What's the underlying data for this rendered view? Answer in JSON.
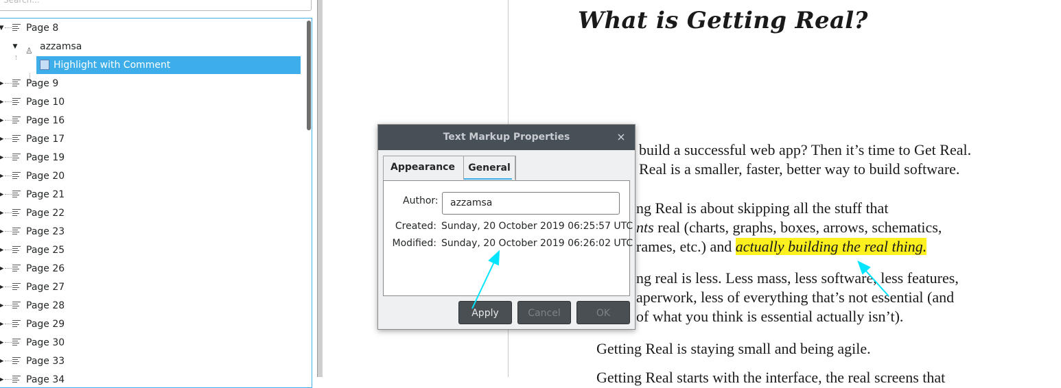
{
  "left_panel": {
    "search_placeholder": "Search...",
    "tree": {
      "page_8": "Page 8",
      "user": "azzamsa",
      "annotation": "Highlight with Comment",
      "pages": [
        "Page 9",
        "Page 10",
        "Page 16",
        "Page 17",
        "Page 19",
        "Page 20",
        "Page 21",
        "Page 22",
        "Page 23",
        "Page 25",
        "Page 26",
        "Page 27",
        "Page 28",
        "Page 29",
        "Page 30",
        "Page 33",
        "Page 34"
      ]
    }
  },
  "document": {
    "title": "What is Getting Real?",
    "lines": {
      "l1": "build a successful web app? Then it’s time to Get Real.",
      "l2": "Real is a smaller, faster, better way to build software.",
      "l3": "ng Real is about skipping all the stuff that",
      "l4_em": "nts",
      "l4_rest": " real (charts, graphs, boxes, arrows, schematics,",
      "l5_pre": "rames, etc.) and ",
      "l5_highlight": "actually building the real thing.",
      "l6": "ng real is less. Less mass, less software, less features,",
      "l7": "aperwork, less of everything that’s not essential (and",
      "l8": "of what you think is essential actually isn’t).",
      "l9": "Getting Real is staying small and being agile.",
      "l10": "Getting Real starts with the interface, the real screens that"
    },
    "highlight_color": "#fdf01f"
  },
  "dialog": {
    "title": "Text Markup Properties",
    "close_glyph": "×",
    "tabs": {
      "appearance": "Appearance",
      "general": "General"
    },
    "author_label": "Author:",
    "author_value": "azzamsa",
    "created_label": "Created:",
    "created_value": "Sunday, 20 October 2019 06:25:57 UTC",
    "modified_label": "Modified:",
    "modified_value": "Sunday, 20 October 2019 06:26:02 UTC",
    "buttons": {
      "apply": "Apply",
      "cancel": "Cancel",
      "ok": "OK"
    }
  },
  "colors": {
    "selection": "#3daee9",
    "annotation_arrow": "#00e5ff"
  }
}
